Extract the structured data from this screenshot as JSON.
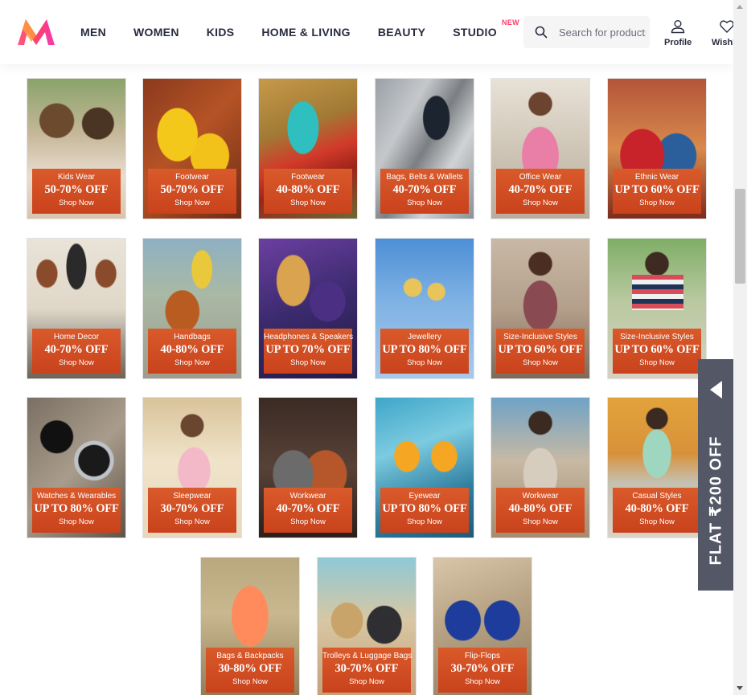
{
  "header": {
    "nav": [
      "MEN",
      "WOMEN",
      "KIDS",
      "HOME & LIVING",
      "BEAUTY",
      "STUDIO"
    ],
    "studio_badge": "NEW",
    "search_placeholder": "Search for products, brands and more",
    "profile_label": "Profile",
    "wishlist_label": "Wishlist"
  },
  "colors": {
    "brand_pink": "#ff3f6c",
    "banner_orange": "#d2502a",
    "side_offer_bg": "#535766"
  },
  "tiles": [
    {
      "category": "Kids Wear",
      "offer": "50-70% OFF",
      "cta": "Shop Now"
    },
    {
      "category": "Footwear",
      "offer": "50-70% OFF",
      "cta": "Shop Now"
    },
    {
      "category": "Footwear",
      "offer": "40-80% OFF",
      "cta": "Shop Now"
    },
    {
      "category": "Bags, Belts & Wallets",
      "offer": "40-70% OFF",
      "cta": "Shop Now"
    },
    {
      "category": "Office Wear",
      "offer": "40-70% OFF",
      "cta": "Shop Now"
    },
    {
      "category": "Ethnic Wear",
      "offer": "UP TO 60% OFF",
      "cta": "Shop Now"
    },
    {
      "category": "Home Decor",
      "offer": "40-70% OFF",
      "cta": "Shop Now"
    },
    {
      "category": "Handbags",
      "offer": "40-80% OFF",
      "cta": "Shop Now"
    },
    {
      "category": "Headphones & Speakers",
      "offer": "UP TO 70% OFF",
      "cta": "Shop Now"
    },
    {
      "category": "Jewellery",
      "offer": "UP TO 80% OFF",
      "cta": "Shop Now"
    },
    {
      "category": "Size-Inclusive Styles",
      "offer": "UP TO 60% OFF",
      "cta": "Shop Now"
    },
    {
      "category": "Size-Inclusive Styles",
      "offer": "UP TO 60% OFF",
      "cta": "Shop Now"
    },
    {
      "category": "Watches & Wearables",
      "offer": "UP TO 80% OFF",
      "cta": "Shop Now"
    },
    {
      "category": "Sleepwear",
      "offer": "30-70% OFF",
      "cta": "Shop Now"
    },
    {
      "category": "Workwear",
      "offer": "40-70% OFF",
      "cta": "Shop Now"
    },
    {
      "category": "Eyewear",
      "offer": "UP TO 80% OFF",
      "cta": "Shop Now"
    },
    {
      "category": "Workwear",
      "offer": "40-80% OFF",
      "cta": "Shop Now"
    },
    {
      "category": "Casual Styles",
      "offer": "40-80% OFF",
      "cta": "Shop Now"
    },
    {
      "category": "Bags & Backpacks",
      "offer": "30-80% OFF",
      "cta": "Shop Now"
    },
    {
      "category": "Trolleys & Luggage Bags",
      "offer": "30-70% OFF",
      "cta": "Shop Now"
    },
    {
      "category": "Flip-Flops",
      "offer": "30-70% OFF",
      "cta": "Shop Now"
    }
  ],
  "side_offer": {
    "text": "FLAT ₹200 OFF"
  }
}
